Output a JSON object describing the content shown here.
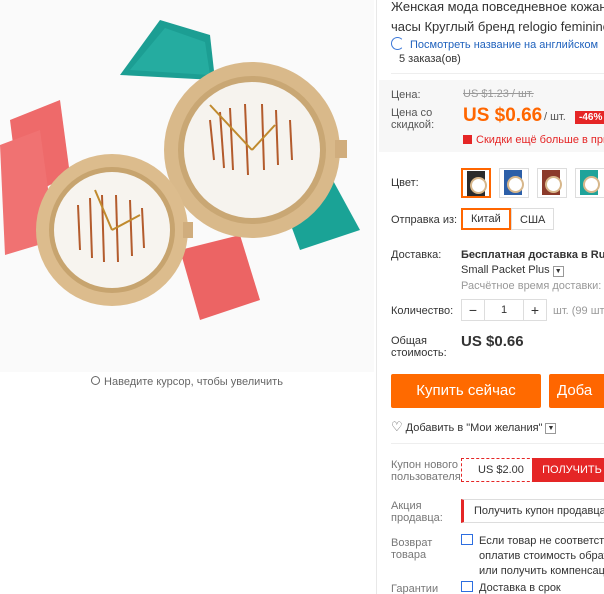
{
  "image": {
    "zoom_hint": "Наведите курсор, чтобы увеличить"
  },
  "product": {
    "title_line1": "Женская мода повседневное кожан",
    "title_line2": "часы Круглый бренд relogio feminino",
    "translate_link": "Посмотреть название на английском",
    "orders": "5 заказа(ов)"
  },
  "price": {
    "label": "Цена:",
    "old": "US $1.23 / шт.",
    "discount_label_1": "Цена со",
    "discount_label_2": "скидкой:",
    "new": "US $0.66",
    "unit": "/ шт.",
    "discount_badge": "-46%",
    "bulk_note": "Скидки ещё больше в прил"
  },
  "color": {
    "label": "Цвет:",
    "swatches": [
      {
        "name": "black-band",
        "band": "#2b2b2b",
        "selected": true
      },
      {
        "name": "blue-band",
        "band": "#2c5fa8",
        "selected": false
      },
      {
        "name": "brown-band",
        "band": "#8b3a2a",
        "selected": false
      },
      {
        "name": "teal-band",
        "band": "#1fa39a",
        "selected": false
      }
    ]
  },
  "ship_from": {
    "label": "Отправка из:",
    "options": [
      "Китай",
      "США"
    ],
    "selected": "Китай"
  },
  "delivery": {
    "label": "Доставка:",
    "method_line1": "Бесплатная доставка в Russ",
    "method_line2": "Small Packet Plus",
    "estimate": "Расчётное время доставки: 2"
  },
  "quantity": {
    "label": "Количество:",
    "minus": "−",
    "value": "1",
    "plus": "+",
    "available": "шт. (99 шт"
  },
  "total": {
    "label_1": "Общая",
    "label_2": "стоимость:",
    "value": "US $0.66"
  },
  "actions": {
    "buy_now": "Купить сейчас",
    "add_to_cart": "Доба",
    "wishlist": "Добавить в \"Мои желания\""
  },
  "coupon": {
    "label_1": "Купон нового",
    "label_2": "пользователя",
    "amount": "US $2.00",
    "get": "ПОЛУЧИТЬ"
  },
  "seller_promo": {
    "label_1": "Акция",
    "label_2": "продавца:",
    "button": "Получить купон продавца"
  },
  "returns": {
    "label_1": "Возврат",
    "label_2": "товара",
    "line1": "Если товар не соответству",
    "line2": "оплатив стоимость обратн",
    "line3": "или получить компенсац"
  },
  "guarantee": {
    "label": "Гарантии",
    "text": "Доставка в срок"
  },
  "colors": {
    "accent": "#ff6a00",
    "sale": "#e52626",
    "link": "#2062bd"
  }
}
